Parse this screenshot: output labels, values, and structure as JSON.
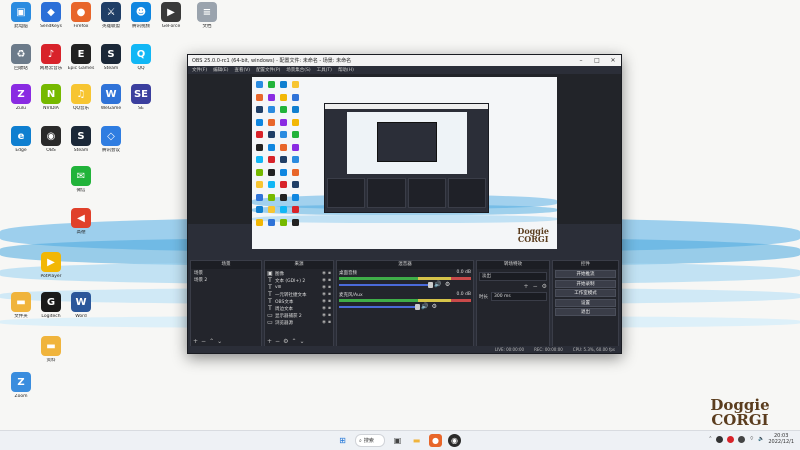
{
  "desktop": {
    "icons": [
      {
        "label": "此电脑",
        "glyph": "▣",
        "color": "#2a8be0"
      },
      {
        "label": "SendKeys",
        "glyph": "◆",
        "color": "#2b6fd8"
      },
      {
        "label": "Firefox",
        "glyph": "●",
        "color": "#e8662a"
      },
      {
        "label": "英雄联盟",
        "glyph": "⚔",
        "color": "#1f3e66"
      },
      {
        "label": "腾讯视频",
        "glyph": "☻",
        "color": "#0f86e0"
      },
      {
        "label": "GeForce",
        "glyph": "▶",
        "color": "#3a3a3a"
      },
      {
        "label": "文档",
        "glyph": "≡",
        "color": "#9aa3ad"
      },
      {
        "label": "回收站",
        "glyph": "♻",
        "color": "#6c7b8a"
      },
      {
        "label": "网易云音乐",
        "glyph": "♪",
        "color": "#d8232a"
      },
      {
        "label": "Epic Games",
        "glyph": "E",
        "color": "#222222"
      },
      {
        "label": "Steam",
        "glyph": "S",
        "color": "#1b2838"
      },
      {
        "label": "QQ",
        "glyph": "Q",
        "color": "#12b7f5"
      },
      {
        "label": "Zulu",
        "glyph": "Z",
        "color": "#8a2be2"
      },
      {
        "label": "NVIDIA",
        "glyph": "N",
        "color": "#76b900"
      },
      {
        "label": "QQ音乐",
        "glyph": "♫",
        "color": "#f7c531"
      },
      {
        "label": "WeGame",
        "glyph": "W",
        "color": "#2f73d8"
      },
      {
        "label": "SE",
        "glyph": "SE",
        "color": "#3b3f9e"
      },
      {
        "label": "Edge",
        "glyph": "e",
        "color": "#0f7fd0"
      },
      {
        "label": "OBS",
        "glyph": "◉",
        "color": "#2a2a2a"
      },
      {
        "label": "Steam",
        "glyph": "S",
        "color": "#1b2838"
      },
      {
        "label": "腾讯会议",
        "glyph": "◇",
        "color": "#2f7de1"
      },
      {
        "label": "PotPlayer",
        "glyph": "▶",
        "color": "#f2b705"
      },
      {
        "label": "Logitech",
        "glyph": "G",
        "color": "#1a1a1a"
      },
      {
        "label": "Word",
        "glyph": "W",
        "color": "#2b579a"
      },
      {
        "label": "文件夹",
        "glyph": "▬",
        "color": "#f0b43c"
      },
      {
        "label": "微信",
        "glyph": "✉",
        "color": "#21b33a"
      },
      {
        "label": "资料",
        "glyph": "▬",
        "color": "#f0b43c"
      },
      {
        "label": "高德",
        "glyph": "◀",
        "color": "#e0402a"
      },
      {
        "label": "Zoom",
        "glyph": "Z",
        "color": "#3a8dde"
      }
    ]
  },
  "obs": {
    "title": "OBS 25.0.0-rc1 (64-bit, windows) - 配置文件: 未命名 - 场景: 未命名",
    "menu": [
      "文件(F)",
      "编辑(E)",
      "查看(V)",
      "配置文件(P)",
      "场景集合(S)",
      "工具(T)",
      "帮助(H)"
    ],
    "preview_watermark": [
      "Doggie",
      "CORGI"
    ],
    "docks": {
      "scenes": {
        "title": "场景",
        "items": [
          "场景",
          "场景 2"
        ]
      },
      "sources": {
        "title": "来源",
        "items": [
          {
            "glyph": "▣",
            "label": "图像"
          },
          {
            "glyph": "T",
            "label": "文本 (GDI+) 2"
          },
          {
            "glyph": "T",
            "label": "vlll"
          },
          {
            "glyph": "T",
            "label": "一元转社捷文本"
          },
          {
            "glyph": "T",
            "label": "OBS文本"
          },
          {
            "glyph": "T",
            "label": "周边文本"
          },
          {
            "glyph": "▭",
            "label": "显示器捕获 2"
          },
          {
            "glyph": "▭",
            "label": "浏览器源"
          }
        ]
      },
      "mixer": {
        "title": "混音器",
        "tracks": [
          {
            "name": "桌面音频",
            "db": "0.0 dB",
            "level": 0.7
          },
          {
            "name": "麦克风/Aux",
            "db": "0.0 dB",
            "level": 0.6
          }
        ]
      },
      "transitions": {
        "title": "转场特效",
        "type": "淡出",
        "duration_label": "时长",
        "duration": "300 ms"
      },
      "controls": {
        "title": "控件",
        "buttons": [
          "开始推流",
          "开始录制",
          "工作室模式",
          "设置",
          "退出"
        ]
      }
    },
    "status": [
      "LIVE: 00:00:00",
      "REC: 00:00:00",
      "CPU: 5.3%, 60.00 fps"
    ]
  },
  "watermark": [
    "Doggie",
    "CORGI"
  ],
  "taskbar": {
    "search_label": "搜索",
    "time": "20:03",
    "date": "2022/12/1"
  }
}
